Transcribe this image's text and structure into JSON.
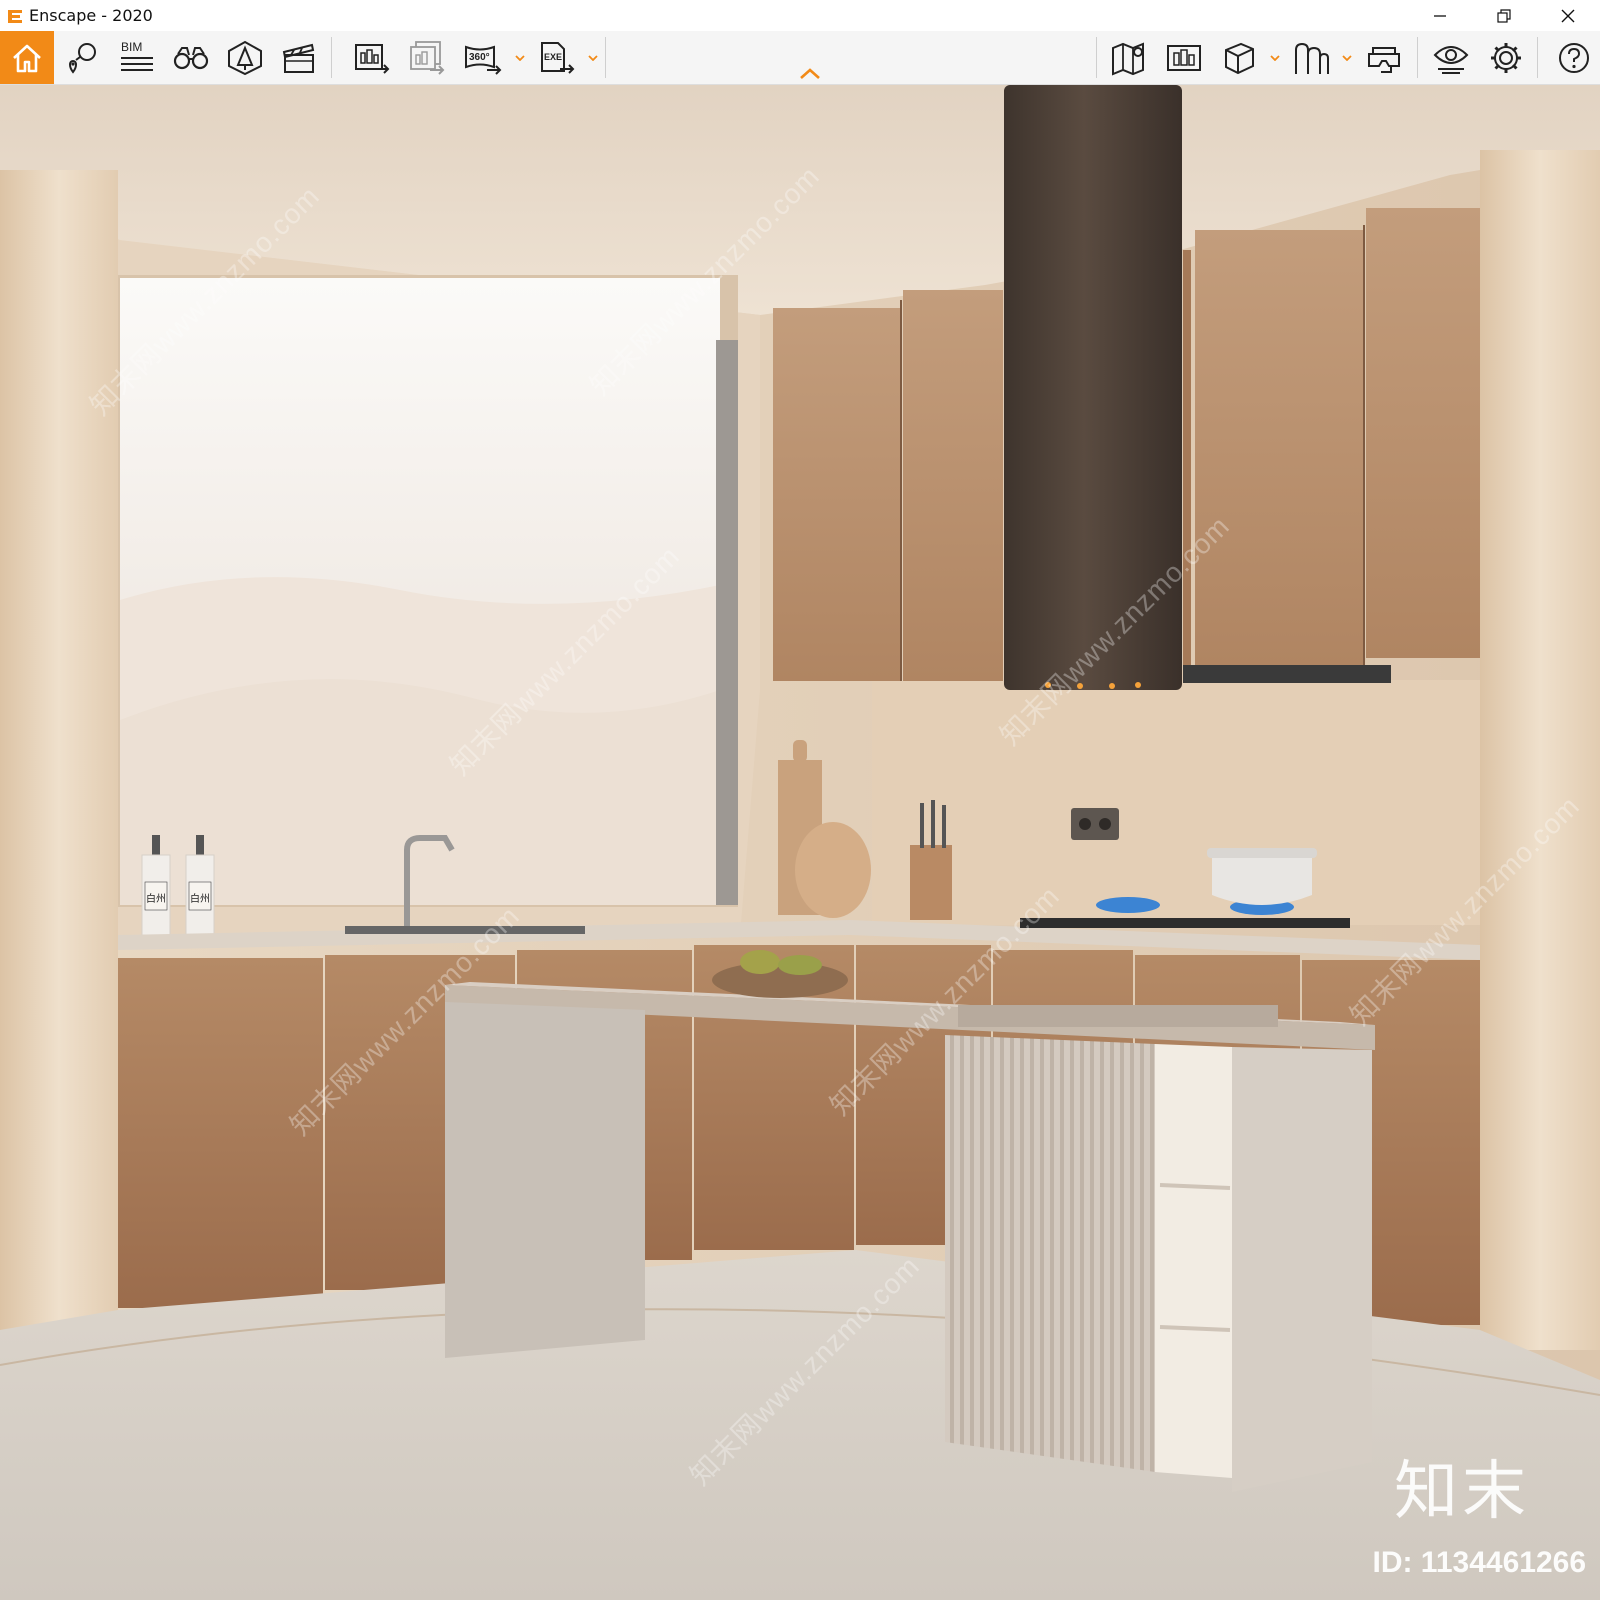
{
  "window": {
    "title": "Enscape - 2020",
    "controls": {
      "minimize": "minimize-icon",
      "restore": "restore-icon",
      "close": "close-icon"
    }
  },
  "toolbar": {
    "left_tools": [
      "home-icon",
      "views-pin-icon",
      "bim-icon",
      "binoculars-icon",
      "asset-library-icon",
      "video-editor-icon",
      "screenshot-render-icon",
      "batch-render-icon",
      "panorama-360-icon",
      "export-exe-icon"
    ],
    "bim_label": "BIM",
    "panorama_label": "360°",
    "exe_label": "EXE",
    "right_tools": [
      "map-icon",
      "capture-gallery-icon",
      "object-cube-icon",
      "people-icon",
      "vr-headset-icon",
      "visual-settings-icon",
      "settings-gear-icon",
      "help-icon"
    ],
    "accent_color": "#f28a17"
  },
  "viewport": {
    "scene": "rendered kitchen interior",
    "bottle_labels": [
      "白州",
      "白州"
    ]
  },
  "watermark": {
    "logo_text": "知末",
    "id_text": "ID: 1134461266",
    "site_text": "知末网www.znzmo.com"
  }
}
